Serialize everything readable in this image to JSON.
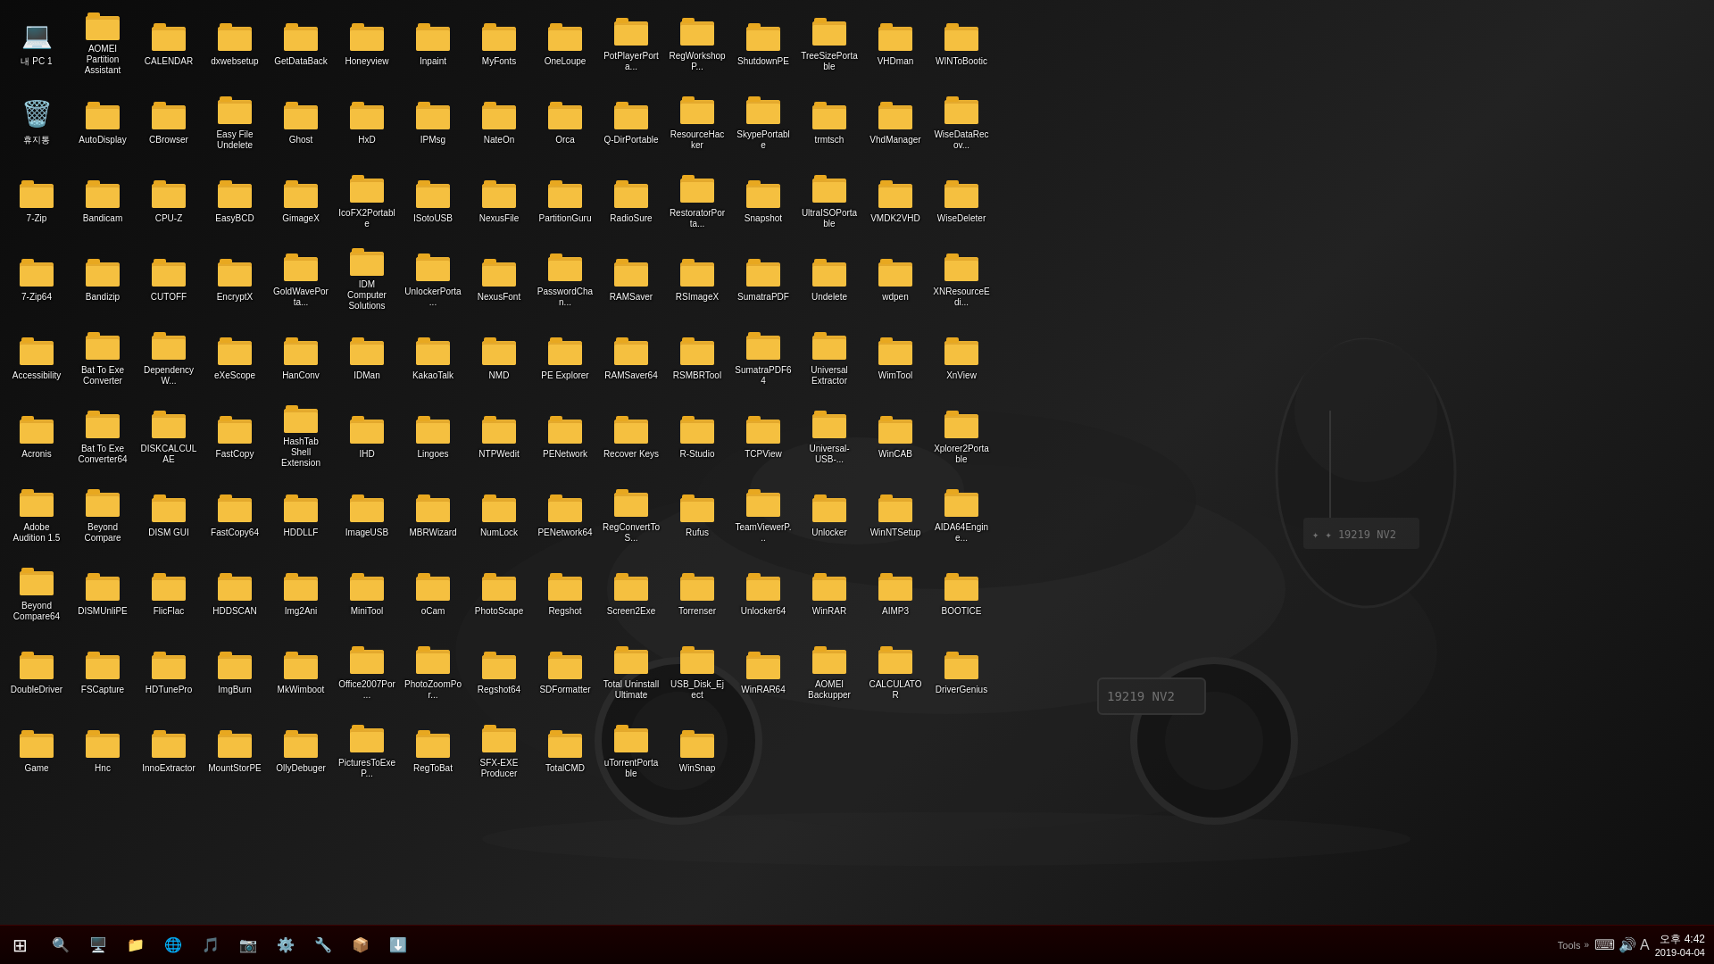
{
  "desktop": {
    "background_color": "#111111",
    "icons": [
      {
        "id": 0,
        "label": "내 PC 1",
        "type": "system",
        "emoji": "💻"
      },
      {
        "id": 1,
        "label": "AOMEI Partition Assistant",
        "type": "folder",
        "emoji": "📁"
      },
      {
        "id": 2,
        "label": "CALENDAR",
        "type": "folder",
        "emoji": "📁"
      },
      {
        "id": 3,
        "label": "dxwebsetup",
        "type": "folder",
        "emoji": "📁"
      },
      {
        "id": 4,
        "label": "GetDataBack",
        "type": "folder",
        "emoji": "📁"
      },
      {
        "id": 5,
        "label": "Honeyview",
        "type": "folder",
        "emoji": "📁"
      },
      {
        "id": 6,
        "label": "Inpaint",
        "type": "folder",
        "emoji": "📁"
      },
      {
        "id": 7,
        "label": "MyFonts",
        "type": "folder",
        "emoji": "📁"
      },
      {
        "id": 8,
        "label": "OneLoupe",
        "type": "folder",
        "emoji": "📁"
      },
      {
        "id": 9,
        "label": "PotPlayerPorta...",
        "type": "folder",
        "emoji": "📁"
      },
      {
        "id": 10,
        "label": "RegWorkshopP...",
        "type": "folder",
        "emoji": "📁"
      },
      {
        "id": 11,
        "label": "ShutdownPE",
        "type": "folder",
        "emoji": "📁"
      },
      {
        "id": 12,
        "label": "TreeSizePortable",
        "type": "folder",
        "emoji": "📁"
      },
      {
        "id": 13,
        "label": "VHDman",
        "type": "folder",
        "emoji": "📁"
      },
      {
        "id": 14,
        "label": "WINToBootic",
        "type": "folder",
        "emoji": "📁"
      },
      {
        "id": 15,
        "label": "휴지통",
        "type": "recycle",
        "emoji": "🗑️"
      },
      {
        "id": 16,
        "label": "AutoDisplay",
        "type": "folder",
        "emoji": "📁"
      },
      {
        "id": 17,
        "label": "CBrowser",
        "type": "folder",
        "emoji": "📁"
      },
      {
        "id": 18,
        "label": "Easy File Undelete",
        "type": "folder",
        "emoji": "📁"
      },
      {
        "id": 19,
        "label": "Ghost",
        "type": "folder",
        "emoji": "📁"
      },
      {
        "id": 20,
        "label": "HxD",
        "type": "folder",
        "emoji": "📁"
      },
      {
        "id": 21,
        "label": "IPMsg",
        "type": "folder",
        "emoji": "📁"
      },
      {
        "id": 22,
        "label": "NateOn",
        "type": "folder",
        "emoji": "📁"
      },
      {
        "id": 23,
        "label": "Orca",
        "type": "folder",
        "emoji": "📁"
      },
      {
        "id": 24,
        "label": "Q-DirPortable",
        "type": "folder",
        "emoji": "📁"
      },
      {
        "id": 25,
        "label": "ResourceHacker",
        "type": "folder",
        "emoji": "📁"
      },
      {
        "id": 26,
        "label": "SkypePortable",
        "type": "folder",
        "emoji": "📁"
      },
      {
        "id": 27,
        "label": "trmtsch",
        "type": "folder",
        "emoji": "📁"
      },
      {
        "id": 28,
        "label": "VhdManager",
        "type": "folder",
        "emoji": "📁"
      },
      {
        "id": 29,
        "label": "WiseDataRecov...",
        "type": "folder",
        "emoji": "📁"
      },
      {
        "id": 30,
        "label": "7-Zip",
        "type": "app",
        "emoji": "🗜️"
      },
      {
        "id": 31,
        "label": "Bandicam",
        "type": "app",
        "emoji": "🎬"
      },
      {
        "id": 32,
        "label": "CPU-Z",
        "type": "folder",
        "emoji": "📁"
      },
      {
        "id": 33,
        "label": "EasyBCD",
        "type": "folder",
        "emoji": "📁"
      },
      {
        "id": 34,
        "label": "GimageX",
        "type": "folder",
        "emoji": "📁"
      },
      {
        "id": 35,
        "label": "IcoFX2Portable",
        "type": "folder",
        "emoji": "📁"
      },
      {
        "id": 36,
        "label": "ISotoUSB",
        "type": "folder",
        "emoji": "📁"
      },
      {
        "id": 37,
        "label": "NexusFile",
        "type": "folder",
        "emoji": "📁"
      },
      {
        "id": 38,
        "label": "PartitionGuru",
        "type": "folder",
        "emoji": "📁"
      },
      {
        "id": 39,
        "label": "RadioSure",
        "type": "folder",
        "emoji": "📁"
      },
      {
        "id": 40,
        "label": "RestoratorPorta...",
        "type": "folder",
        "emoji": "📁"
      },
      {
        "id": 41,
        "label": "Snapshot",
        "type": "folder",
        "emoji": "📁"
      },
      {
        "id": 42,
        "label": "UltraISOPortable",
        "type": "folder",
        "emoji": "📁"
      },
      {
        "id": 43,
        "label": "VMDK2VHD",
        "type": "folder",
        "emoji": "📁"
      },
      {
        "id": 44,
        "label": "WiseDeleter",
        "type": "folder",
        "emoji": "📁"
      },
      {
        "id": 45,
        "label": "7-Zip64",
        "type": "app",
        "emoji": "🗜️"
      },
      {
        "id": 46,
        "label": "Bandizip",
        "type": "folder",
        "emoji": "📁"
      },
      {
        "id": 47,
        "label": "CUTOFF",
        "type": "folder",
        "emoji": "📁"
      },
      {
        "id": 48,
        "label": "EncryptX",
        "type": "folder",
        "emoji": "📁"
      },
      {
        "id": 49,
        "label": "GoldWavePorta...",
        "type": "folder",
        "emoji": "📁"
      },
      {
        "id": 50,
        "label": "IDM Computer Solutions",
        "type": "folder",
        "emoji": "📁"
      },
      {
        "id": 51,
        "label": "UnlockerPorta...",
        "type": "folder",
        "emoji": "📁"
      },
      {
        "id": 52,
        "label": "NexusFont",
        "type": "folder",
        "emoji": "📁"
      },
      {
        "id": 53,
        "label": "PasswordChan...",
        "type": "folder",
        "emoji": "📁"
      },
      {
        "id": 54,
        "label": "RAMSaver",
        "type": "folder",
        "emoji": "📁"
      },
      {
        "id": 55,
        "label": "RSImageX",
        "type": "folder",
        "emoji": "📁"
      },
      {
        "id": 56,
        "label": "SumatraPDF",
        "type": "folder",
        "emoji": "📁"
      },
      {
        "id": 57,
        "label": "Undelete",
        "type": "folder",
        "emoji": "📁"
      },
      {
        "id": 58,
        "label": "wdpen",
        "type": "folder",
        "emoji": "📁"
      },
      {
        "id": 59,
        "label": "XNResourceEdi...",
        "type": "folder",
        "emoji": "📁"
      },
      {
        "id": 60,
        "label": "Accessibility",
        "type": "folder",
        "emoji": "📁"
      },
      {
        "id": 61,
        "label": "Bat To Exe Converter",
        "type": "folder",
        "emoji": "📁"
      },
      {
        "id": 62,
        "label": "DependencyW...",
        "type": "folder",
        "emoji": "📁"
      },
      {
        "id": 63,
        "label": "eXeScope",
        "type": "folder",
        "emoji": "📁"
      },
      {
        "id": 64,
        "label": "HanConv",
        "type": "folder",
        "emoji": "📁"
      },
      {
        "id": 65,
        "label": "IDMan",
        "type": "folder",
        "emoji": "📁"
      },
      {
        "id": 66,
        "label": "KakaoTalk",
        "type": "folder",
        "emoji": "📁"
      },
      {
        "id": 67,
        "label": "NMD",
        "type": "folder",
        "emoji": "📁"
      },
      {
        "id": 68,
        "label": "PE Explorer",
        "type": "folder",
        "emoji": "📁"
      },
      {
        "id": 69,
        "label": "RAMSaver64",
        "type": "folder",
        "emoji": "📁"
      },
      {
        "id": 70,
        "label": "RSMBRTool",
        "type": "folder",
        "emoji": "📁"
      },
      {
        "id": 71,
        "label": "SumatraPDF64",
        "type": "folder",
        "emoji": "📁"
      },
      {
        "id": 72,
        "label": "Universal Extractor",
        "type": "folder",
        "emoji": "📁"
      },
      {
        "id": 73,
        "label": "WimTool",
        "type": "folder",
        "emoji": "📁"
      },
      {
        "id": 74,
        "label": "XnView",
        "type": "folder",
        "emoji": "📁"
      },
      {
        "id": 75,
        "label": "Acronis",
        "type": "folder",
        "emoji": "📁"
      },
      {
        "id": 76,
        "label": "Bat To Exe Converter64",
        "type": "folder",
        "emoji": "📁"
      },
      {
        "id": 77,
        "label": "DISKCALCULAE",
        "type": "folder",
        "emoji": "📁"
      },
      {
        "id": 78,
        "label": "FastCopy",
        "type": "folder",
        "emoji": "📁"
      },
      {
        "id": 79,
        "label": "HashTab Shell Extension",
        "type": "folder",
        "emoji": "📁"
      },
      {
        "id": 80,
        "label": "IHD",
        "type": "folder",
        "emoji": "📁"
      },
      {
        "id": 81,
        "label": "Lingoes",
        "type": "folder",
        "emoji": "📁"
      },
      {
        "id": 82,
        "label": "NTPWedit",
        "type": "folder",
        "emoji": "📁"
      },
      {
        "id": 83,
        "label": "PENetwork",
        "type": "folder",
        "emoji": "📁"
      },
      {
        "id": 84,
        "label": "Recover Keys",
        "type": "folder",
        "emoji": "📁"
      },
      {
        "id": 85,
        "label": "R-Studio",
        "type": "folder",
        "emoji": "📁"
      },
      {
        "id": 86,
        "label": "TCPView",
        "type": "folder",
        "emoji": "📁"
      },
      {
        "id": 87,
        "label": "Universal-USB-...",
        "type": "folder",
        "emoji": "📁"
      },
      {
        "id": 88,
        "label": "WinCAB",
        "type": "folder",
        "emoji": "📁"
      },
      {
        "id": 89,
        "label": "Xplorer2Portable",
        "type": "folder",
        "emoji": "📁"
      },
      {
        "id": 90,
        "label": "Adobe Audition 1.5",
        "type": "folder",
        "emoji": "📁"
      },
      {
        "id": 91,
        "label": "Beyond Compare",
        "type": "folder",
        "emoji": "📁"
      },
      {
        "id": 92,
        "label": "DISM GUI",
        "type": "folder",
        "emoji": "📁"
      },
      {
        "id": 93,
        "label": "FastCopy64",
        "type": "folder",
        "emoji": "📁"
      },
      {
        "id": 94,
        "label": "HDDLLF",
        "type": "folder",
        "emoji": "📁"
      },
      {
        "id": 95,
        "label": "ImageUSB",
        "type": "folder",
        "emoji": "📁"
      },
      {
        "id": 96,
        "label": "MBRWizard",
        "type": "folder",
        "emoji": "📁"
      },
      {
        "id": 97,
        "label": "NumLock",
        "type": "folder",
        "emoji": "📁"
      },
      {
        "id": 98,
        "label": "PENetwork64",
        "type": "folder",
        "emoji": "📁"
      },
      {
        "id": 99,
        "label": "RegConvertToS...",
        "type": "folder",
        "emoji": "📁"
      },
      {
        "id": 100,
        "label": "Rufus",
        "type": "folder",
        "emoji": "📁"
      },
      {
        "id": 101,
        "label": "TeamViewerP...",
        "type": "folder",
        "emoji": "📁"
      },
      {
        "id": 102,
        "label": "Unlocker",
        "type": "folder",
        "emoji": "📁"
      },
      {
        "id": 103,
        "label": "WinNTSetup",
        "type": "folder",
        "emoji": "📁"
      },
      {
        "id": 104,
        "label": "AIDA64Engine...",
        "type": "folder",
        "emoji": "📁"
      },
      {
        "id": 105,
        "label": "Beyond Compare64",
        "type": "folder",
        "emoji": "📁"
      },
      {
        "id": 106,
        "label": "DISMUnliPE",
        "type": "folder",
        "emoji": "📁"
      },
      {
        "id": 107,
        "label": "FlicFlac",
        "type": "folder",
        "emoji": "📁"
      },
      {
        "id": 108,
        "label": "HDDSCAN",
        "type": "folder",
        "emoji": "📁"
      },
      {
        "id": 109,
        "label": "Img2Ani",
        "type": "folder",
        "emoji": "📁"
      },
      {
        "id": 110,
        "label": "MiniTool",
        "type": "folder",
        "emoji": "📁"
      },
      {
        "id": 111,
        "label": "oCam",
        "type": "folder",
        "emoji": "📁"
      },
      {
        "id": 112,
        "label": "PhotoScape",
        "type": "folder",
        "emoji": "📁"
      },
      {
        "id": 113,
        "label": "Regshot",
        "type": "folder",
        "emoji": "📁"
      },
      {
        "id": 114,
        "label": "Screen2Exe",
        "type": "folder",
        "emoji": "📁"
      },
      {
        "id": 115,
        "label": "Torrenser",
        "type": "folder",
        "emoji": "📁"
      },
      {
        "id": 116,
        "label": "Unlocker64",
        "type": "folder",
        "emoji": "📁"
      },
      {
        "id": 117,
        "label": "WinRAR",
        "type": "folder",
        "emoji": "📁"
      },
      {
        "id": 118,
        "label": "AIMP3",
        "type": "folder",
        "emoji": "📁"
      },
      {
        "id": 119,
        "label": "BOOTICE",
        "type": "folder",
        "emoji": "📁"
      },
      {
        "id": 120,
        "label": "DoubleDriver",
        "type": "folder",
        "emoji": "📁"
      },
      {
        "id": 121,
        "label": "FSCapture",
        "type": "folder",
        "emoji": "📁"
      },
      {
        "id": 122,
        "label": "HDTunePro",
        "type": "folder",
        "emoji": "📁"
      },
      {
        "id": 123,
        "label": "ImgBurn",
        "type": "folder",
        "emoji": "📁"
      },
      {
        "id": 124,
        "label": "MkWimboot",
        "type": "folder",
        "emoji": "📁"
      },
      {
        "id": 125,
        "label": "Office2007Por...",
        "type": "folder",
        "emoji": "📁"
      },
      {
        "id": 126,
        "label": "PhotoZoomPor...",
        "type": "folder",
        "emoji": "📁"
      },
      {
        "id": 127,
        "label": "Regshot64",
        "type": "folder",
        "emoji": "📁"
      },
      {
        "id": 128,
        "label": "SDFormatter",
        "type": "folder",
        "emoji": "📁"
      },
      {
        "id": 129,
        "label": "Total Uninstall Ultimate",
        "type": "folder",
        "emoji": "📁"
      },
      {
        "id": 130,
        "label": "USB_Disk_Eject",
        "type": "folder",
        "emoji": "📁"
      },
      {
        "id": 131,
        "label": "WinRAR64",
        "type": "folder",
        "emoji": "📁"
      },
      {
        "id": 132,
        "label": "AOMEI Backupper",
        "type": "folder",
        "emoji": "📁"
      },
      {
        "id": 133,
        "label": "CALCULATOR",
        "type": "folder",
        "emoji": "📁"
      },
      {
        "id": 134,
        "label": "DriverGenius",
        "type": "folder",
        "emoji": "📁"
      },
      {
        "id": 135,
        "label": "Game",
        "type": "folder",
        "emoji": "📁"
      },
      {
        "id": 136,
        "label": "Hnc",
        "type": "folder",
        "emoji": "📁"
      },
      {
        "id": 137,
        "label": "InnoExtractor",
        "type": "folder",
        "emoji": "📁"
      },
      {
        "id": 138,
        "label": "MountStorPE",
        "type": "folder",
        "emoji": "📁"
      },
      {
        "id": 139,
        "label": "OllyDebuger",
        "type": "folder",
        "emoji": "📁"
      },
      {
        "id": 140,
        "label": "PicturesToExeP...",
        "type": "folder",
        "emoji": "📁"
      },
      {
        "id": 141,
        "label": "RegToBat",
        "type": "folder",
        "emoji": "📁"
      },
      {
        "id": 142,
        "label": "SFX-EXE Producer",
        "type": "folder",
        "emoji": "📁"
      },
      {
        "id": 143,
        "label": "TotalCMD",
        "type": "folder",
        "emoji": "📁"
      },
      {
        "id": 144,
        "label": "uTorrentPortable",
        "type": "folder",
        "emoji": "📁"
      },
      {
        "id": 145,
        "label": "WinSnap",
        "type": "folder",
        "emoji": "📁"
      }
    ]
  },
  "taskbar": {
    "start_icon": "⊞",
    "tools_label": "Tools",
    "time": "오후 4:42",
    "date": "2019-04-04",
    "taskbar_items": [
      "🖥️",
      "📁",
      "🌐",
      "🎵",
      "📷",
      "⚙️",
      "🔧",
      "📦",
      "⬇️"
    ]
  }
}
